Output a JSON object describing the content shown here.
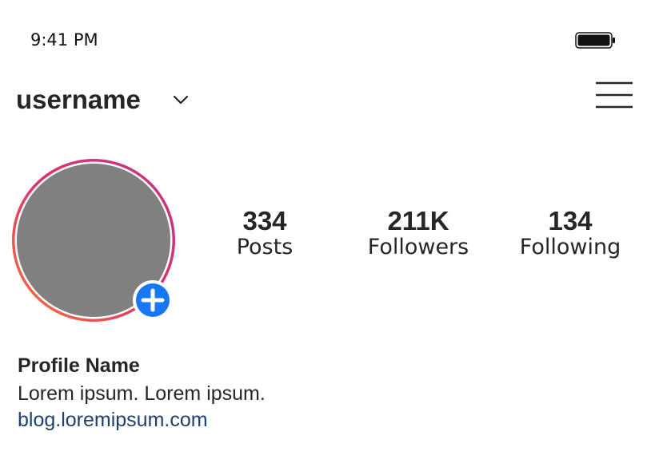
{
  "status_bar": {
    "time": "9:41 PM",
    "battery_icon": "battery-full-icon"
  },
  "header": {
    "username": "username",
    "dropdown_icon": "chevron-down-icon",
    "menu_icon": "hamburger-menu-icon"
  },
  "profile": {
    "avatar_icon": "avatar-placeholder",
    "add_story_icon": "plus-circle-icon",
    "ring_colors": [
      "#c13584",
      "#e1306c",
      "#f77737"
    ],
    "add_button_color": "#1877f2",
    "stats": [
      {
        "count": "334",
        "label": "Posts"
      },
      {
        "count": "211K",
        "label": "Followers"
      },
      {
        "count": "134",
        "label": "Following"
      }
    ]
  },
  "bio": {
    "name": "Profile Name",
    "text": "Lorem ipsum. Lorem ipsum.",
    "link": "blog.loremipsum.com",
    "link_color": "#1f3f6e"
  }
}
